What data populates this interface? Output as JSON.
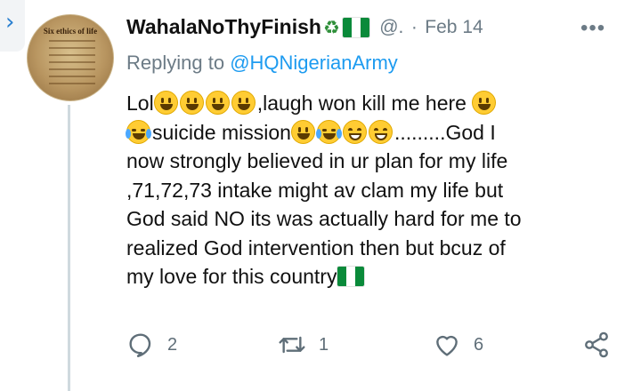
{
  "tweet": {
    "author": {
      "display_name": "WahalaNoThyFinish",
      "name_icons": [
        "recycle-icon",
        "nigeria-flag-icon"
      ],
      "handle": "@.",
      "avatar_text": {
        "title": "Six ethics of life"
      }
    },
    "separator": "·",
    "date": "Feb 14",
    "more_label": "•••",
    "reply_to": {
      "prefix": "Replying to ",
      "mention": "@HQNigerianArmy"
    },
    "body": {
      "line1": {
        "before": "Lol",
        "after": ",laugh won kill me here "
      },
      "line2": {
        "text1": "suicide mission",
        "text2": ".........God I"
      },
      "line3": "now strongly believed in ur plan for my life",
      "line4": ",71,72,73 intake might av clam my life but",
      "line5": "God said NO its was actually hard for me to",
      "line6": "realized God intervention then but bcuz of",
      "line7": "my love for this country"
    },
    "actions": {
      "reply": {
        "icon": "reply-icon",
        "count": "2"
      },
      "retweet": {
        "icon": "retweet-icon",
        "count": "1"
      },
      "like": {
        "icon": "heart-icon",
        "count": "6"
      },
      "share": {
        "icon": "share-icon"
      }
    }
  },
  "colors": {
    "accent": "#1d9bf0",
    "muted": "#6c7b86",
    "flag_green": "#0a8a3a"
  }
}
